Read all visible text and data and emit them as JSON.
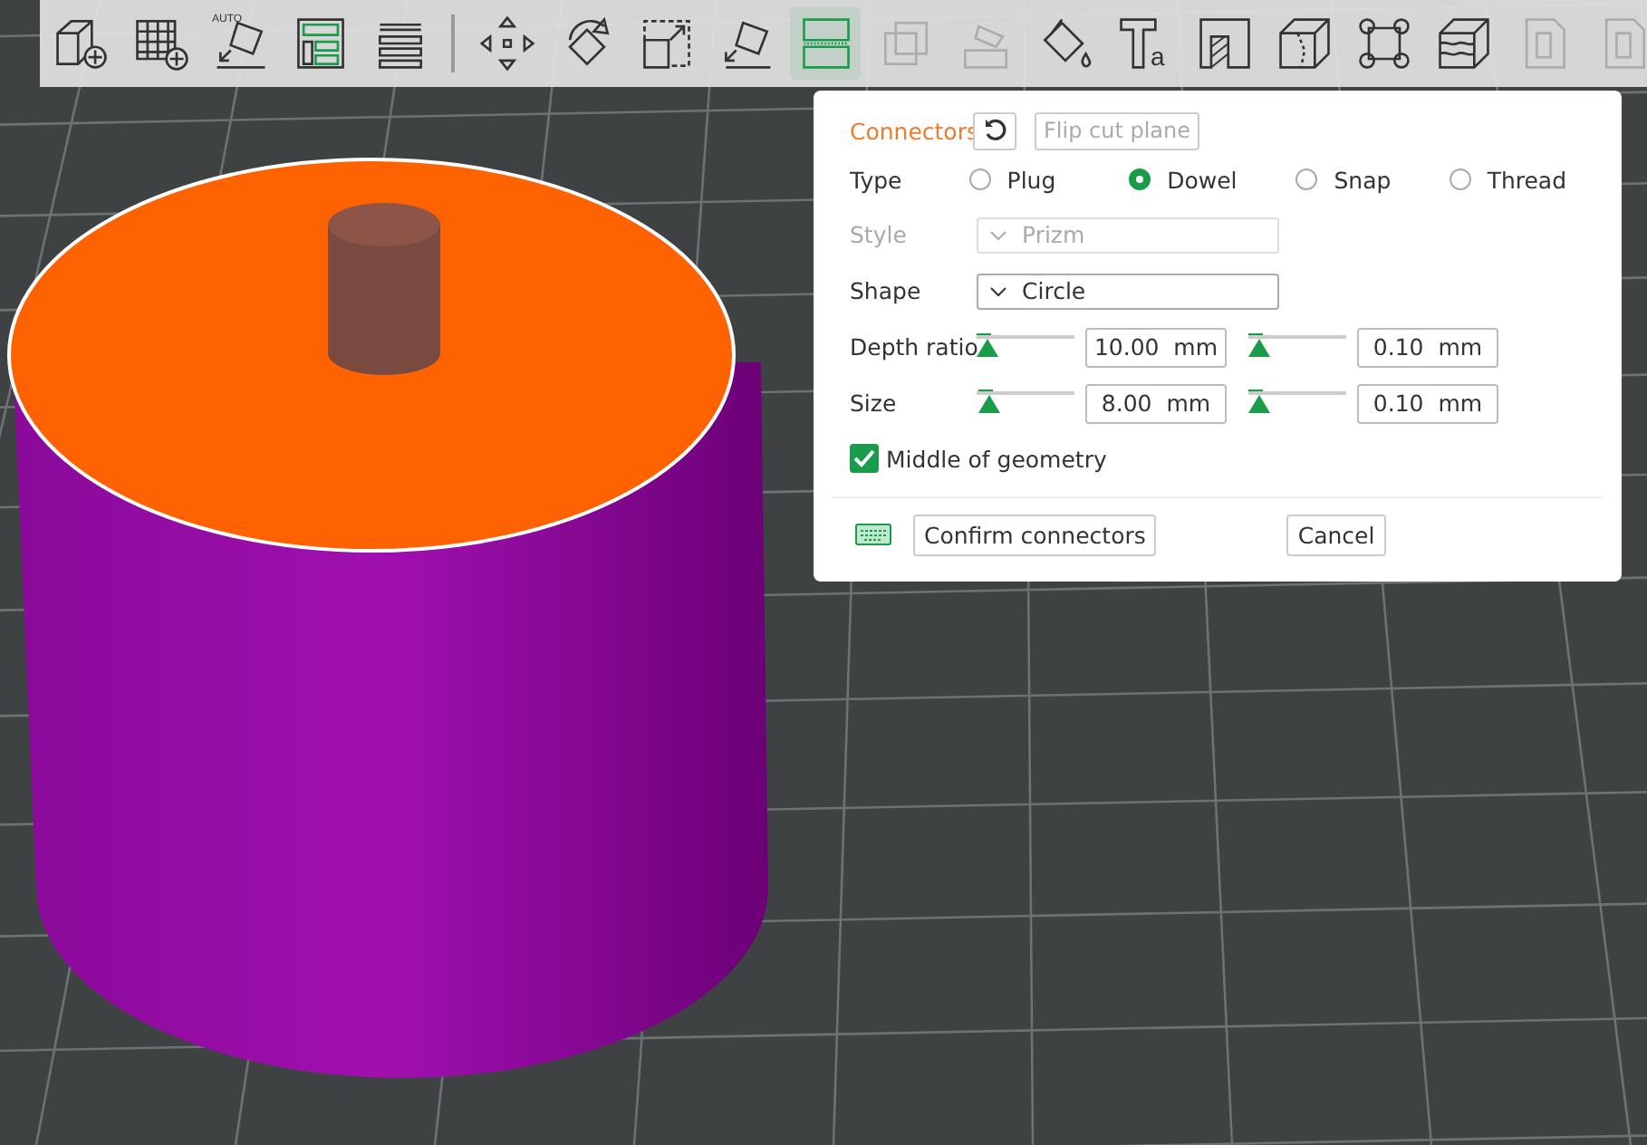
{
  "toolbar": {
    "items": [
      {
        "kind": "add-cube",
        "selected": false,
        "disabled": false
      },
      {
        "kind": "add-plate",
        "selected": false,
        "disabled": false
      },
      {
        "kind": "auto-orient",
        "label": "AUTO",
        "selected": false,
        "disabled": false
      },
      {
        "kind": "arrange",
        "selected": false,
        "disabled": false
      },
      {
        "kind": "plates",
        "selected": false,
        "disabled": false
      },
      {
        "kind": "divider"
      },
      {
        "kind": "move",
        "selected": false,
        "disabled": false
      },
      {
        "kind": "rotate",
        "selected": false,
        "disabled": false
      },
      {
        "kind": "scale",
        "selected": false,
        "disabled": false
      },
      {
        "kind": "lay-face",
        "selected": false,
        "disabled": false
      },
      {
        "kind": "cut",
        "selected": true,
        "disabled": false
      },
      {
        "kind": "boolean",
        "selected": false,
        "disabled": true
      },
      {
        "kind": "support-paint",
        "selected": false,
        "disabled": true
      },
      {
        "kind": "paint",
        "selected": false,
        "disabled": false
      },
      {
        "kind": "text",
        "label": "a",
        "selected": false,
        "disabled": false
      },
      {
        "kind": "emboss",
        "selected": false,
        "disabled": false
      },
      {
        "kind": "seam",
        "selected": false,
        "disabled": false
      },
      {
        "kind": "measure",
        "selected": false,
        "disabled": false
      },
      {
        "kind": "layers",
        "selected": false,
        "disabled": false
      },
      {
        "kind": "assembly",
        "selected": false,
        "disabled": true
      },
      {
        "kind": "assembly",
        "selected": false,
        "disabled": true
      }
    ]
  },
  "panel": {
    "title": "Connectors",
    "flip_button": "Flip cut plane",
    "type_label": "Type",
    "types": [
      {
        "label": "Plug",
        "selected": false
      },
      {
        "label": "Dowel",
        "selected": true
      },
      {
        "label": "Snap",
        "selected": false
      },
      {
        "label": "Thread",
        "selected": false
      }
    ],
    "style": {
      "label": "Style",
      "value": "Prizm",
      "disabled": true
    },
    "shape": {
      "label": "Shape",
      "value": "Circle",
      "disabled": false
    },
    "sliders": [
      {
        "label": "Depth ratio",
        "main": {
          "level": 0.0,
          "value": "10.00  mm"
        },
        "tolerance": {
          "level": 0.0,
          "value": "0.10  mm"
        }
      },
      {
        "label": "Size",
        "main": {
          "level": 0.03,
          "value": "8.00  mm"
        },
        "tolerance": {
          "level": 0.0,
          "value": "0.10  mm"
        }
      }
    ],
    "middle": {
      "label": "Middle of geometry",
      "checked": true
    },
    "confirm": "Confirm connectors",
    "cancel": "Cancel"
  }
}
